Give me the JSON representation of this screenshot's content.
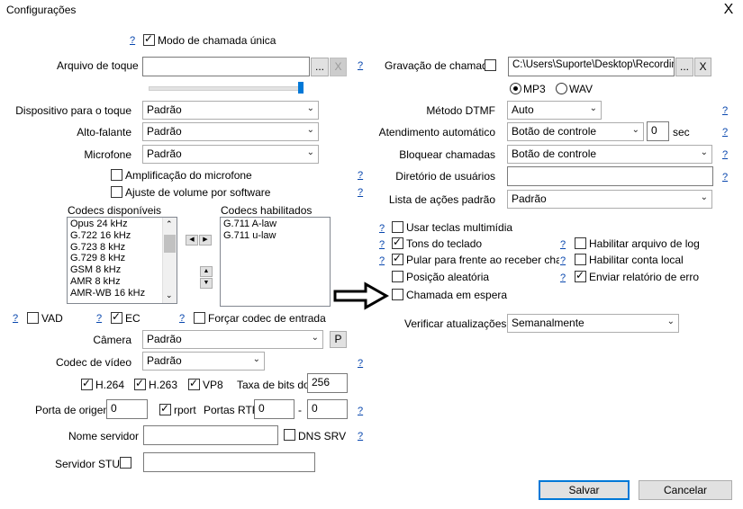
{
  "window": {
    "title": "Configurações",
    "close": "X"
  },
  "help": "?",
  "single_call_mode": "Modo de chamada única",
  "ringtone": {
    "label": "Arquivo de toque",
    "value": "",
    "browse": "...",
    "clear": "X"
  },
  "recording": {
    "label": "Gravação de chamada",
    "path": "C:\\Users\\Suporte\\Desktop\\Recording",
    "browse": "...",
    "clear": "X",
    "mp3": "MP3",
    "wav": "WAV"
  },
  "playback_device": {
    "label": "Dispositivo para o toque",
    "value": "Padrão"
  },
  "speaker": {
    "label": "Alto-falante",
    "value": "Padrão"
  },
  "microphone": {
    "label": "Microfone",
    "value": "Padrão"
  },
  "mic_amplification": "Amplificação do microfone",
  "software_volume": "Ajuste de volume por software",
  "codecs_available": {
    "label": "Codecs disponíveis",
    "items": [
      "Opus 24 kHz",
      "G.722 16 kHz",
      "G.723 8 kHz",
      "G.729 8 kHz",
      "GSM 8 kHz",
      "AMR 8 kHz",
      "AMR-WB 16 kHz"
    ]
  },
  "codecs_enabled": {
    "label": "Codecs habilitados",
    "items": [
      "G.711 A-law",
      "G.711 u-law"
    ]
  },
  "vad": "VAD",
  "ec": "EC",
  "force_codec": "Forçar codec de entrada",
  "camera": {
    "label": "Câmera",
    "value": "Padrão",
    "button": "P"
  },
  "video_codec": {
    "label": "Codec de vídeo",
    "value": "Padrão"
  },
  "h264": "H.264",
  "h263": "H.263",
  "vp8": "VP8",
  "bitrate": {
    "label": "Taxa de bits do",
    "value": "256"
  },
  "source_port": {
    "label": "Porta de origem",
    "value": "0"
  },
  "rport": "rport",
  "rtp_ports": {
    "label": "Portas RTP",
    "from": "0",
    "sep": "-",
    "to": "0"
  },
  "server_name": {
    "label": "Nome servidor",
    "value": ""
  },
  "dns_srv": "DNS SRV",
  "stun_server": {
    "label": "Servidor STUN",
    "value": ""
  },
  "dtmf": {
    "label": "Método DTMF",
    "value": "Auto"
  },
  "auto_answer": {
    "label": "Atendimento automático",
    "value": "Botão de controle",
    "seconds": "0",
    "unit": "sec"
  },
  "block_calls": {
    "label": "Bloquear chamadas",
    "value": "Botão de controle"
  },
  "user_directory": {
    "label": "Diretório de usuários",
    "value": ""
  },
  "default_actions": {
    "label": "Lista de ações padrão",
    "value": "Padrão"
  },
  "multimedia_keys": "Usar teclas multimídia",
  "keypad_tones": "Tons do teclado",
  "skip_on_answer": "Pular para frente ao receber chamada",
  "random_position": "Posição aleatória",
  "call_waiting": "Chamada em espera",
  "enable_log": "Habilitar arquivo de log",
  "enable_local_account": "Habilitar conta local",
  "send_error_report": "Enviar relatório de erro",
  "check_updates": {
    "label": "Verificar atualizações",
    "value": "Semanalmente"
  },
  "buttons": {
    "save": "Salvar",
    "cancel": "Cancelar"
  }
}
